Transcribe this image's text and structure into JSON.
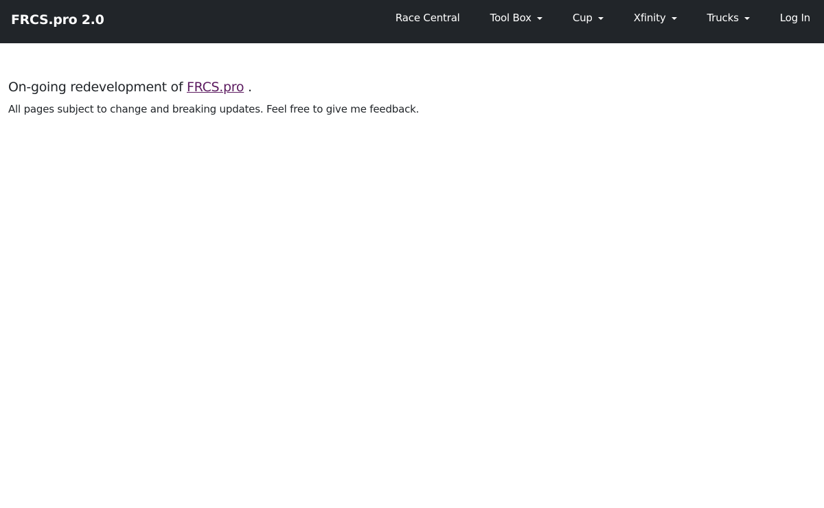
{
  "navbar": {
    "brand": "FRCS.pro 2.0",
    "items": [
      {
        "label": "Race Central",
        "dropdown": false
      },
      {
        "label": "Tool Box",
        "dropdown": true
      },
      {
        "label": "Cup",
        "dropdown": true
      },
      {
        "label": "Xfinity",
        "dropdown": true
      },
      {
        "label": "Trucks",
        "dropdown": true
      },
      {
        "label": "Log In",
        "dropdown": false
      }
    ]
  },
  "main": {
    "lead_prefix": "On-going redevelopment of ",
    "lead_link": "FRCS.pro",
    "lead_suffix": " .",
    "subtext": "All pages subject to change and breaking updates. Feel free to give me feedback."
  },
  "colors": {
    "navbar_bg": "#212529",
    "link": "#5b1a5f"
  }
}
